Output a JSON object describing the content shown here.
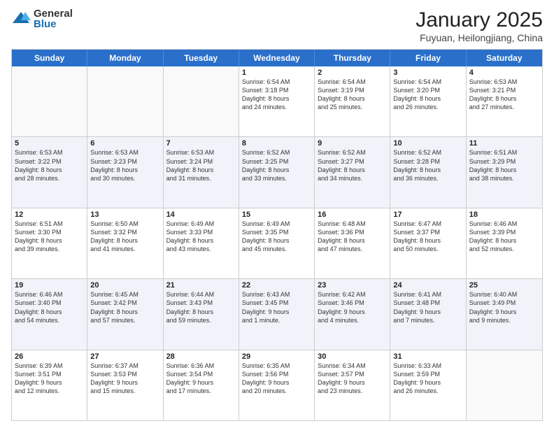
{
  "logo": {
    "general": "General",
    "blue": "Blue"
  },
  "header": {
    "month": "January 2025",
    "location": "Fuyuan, Heilongjiang, China"
  },
  "days": [
    "Sunday",
    "Monday",
    "Tuesday",
    "Wednesday",
    "Thursday",
    "Friday",
    "Saturday"
  ],
  "weeks": [
    [
      {
        "day": "",
        "content": ""
      },
      {
        "day": "",
        "content": ""
      },
      {
        "day": "",
        "content": ""
      },
      {
        "day": "1",
        "content": "Sunrise: 6:54 AM\nSunset: 3:18 PM\nDaylight: 8 hours\nand 24 minutes."
      },
      {
        "day": "2",
        "content": "Sunrise: 6:54 AM\nSunset: 3:19 PM\nDaylight: 8 hours\nand 25 minutes."
      },
      {
        "day": "3",
        "content": "Sunrise: 6:54 AM\nSunset: 3:20 PM\nDaylight: 8 hours\nand 26 minutes."
      },
      {
        "day": "4",
        "content": "Sunrise: 6:53 AM\nSunset: 3:21 PM\nDaylight: 8 hours\nand 27 minutes."
      }
    ],
    [
      {
        "day": "5",
        "content": "Sunrise: 6:53 AM\nSunset: 3:22 PM\nDaylight: 8 hours\nand 28 minutes."
      },
      {
        "day": "6",
        "content": "Sunrise: 6:53 AM\nSunset: 3:23 PM\nDaylight: 8 hours\nand 30 minutes."
      },
      {
        "day": "7",
        "content": "Sunrise: 6:53 AM\nSunset: 3:24 PM\nDaylight: 8 hours\nand 31 minutes."
      },
      {
        "day": "8",
        "content": "Sunrise: 6:52 AM\nSunset: 3:25 PM\nDaylight: 8 hours\nand 33 minutes."
      },
      {
        "day": "9",
        "content": "Sunrise: 6:52 AM\nSunset: 3:27 PM\nDaylight: 8 hours\nand 34 minutes."
      },
      {
        "day": "10",
        "content": "Sunrise: 6:52 AM\nSunset: 3:28 PM\nDaylight: 8 hours\nand 36 minutes."
      },
      {
        "day": "11",
        "content": "Sunrise: 6:51 AM\nSunset: 3:29 PM\nDaylight: 8 hours\nand 38 minutes."
      }
    ],
    [
      {
        "day": "12",
        "content": "Sunrise: 6:51 AM\nSunset: 3:30 PM\nDaylight: 8 hours\nand 39 minutes."
      },
      {
        "day": "13",
        "content": "Sunrise: 6:50 AM\nSunset: 3:32 PM\nDaylight: 8 hours\nand 41 minutes."
      },
      {
        "day": "14",
        "content": "Sunrise: 6:49 AM\nSunset: 3:33 PM\nDaylight: 8 hours\nand 43 minutes."
      },
      {
        "day": "15",
        "content": "Sunrise: 6:49 AM\nSunset: 3:35 PM\nDaylight: 8 hours\nand 45 minutes."
      },
      {
        "day": "16",
        "content": "Sunrise: 6:48 AM\nSunset: 3:36 PM\nDaylight: 8 hours\nand 47 minutes."
      },
      {
        "day": "17",
        "content": "Sunrise: 6:47 AM\nSunset: 3:37 PM\nDaylight: 8 hours\nand 50 minutes."
      },
      {
        "day": "18",
        "content": "Sunrise: 6:46 AM\nSunset: 3:39 PM\nDaylight: 8 hours\nand 52 minutes."
      }
    ],
    [
      {
        "day": "19",
        "content": "Sunrise: 6:46 AM\nSunset: 3:40 PM\nDaylight: 8 hours\nand 54 minutes."
      },
      {
        "day": "20",
        "content": "Sunrise: 6:45 AM\nSunset: 3:42 PM\nDaylight: 8 hours\nand 57 minutes."
      },
      {
        "day": "21",
        "content": "Sunrise: 6:44 AM\nSunset: 3:43 PM\nDaylight: 8 hours\nand 59 minutes."
      },
      {
        "day": "22",
        "content": "Sunrise: 6:43 AM\nSunset: 3:45 PM\nDaylight: 9 hours\nand 1 minute."
      },
      {
        "day": "23",
        "content": "Sunrise: 6:42 AM\nSunset: 3:46 PM\nDaylight: 9 hours\nand 4 minutes."
      },
      {
        "day": "24",
        "content": "Sunrise: 6:41 AM\nSunset: 3:48 PM\nDaylight: 9 hours\nand 7 minutes."
      },
      {
        "day": "25",
        "content": "Sunrise: 6:40 AM\nSunset: 3:49 PM\nDaylight: 9 hours\nand 9 minutes."
      }
    ],
    [
      {
        "day": "26",
        "content": "Sunrise: 6:39 AM\nSunset: 3:51 PM\nDaylight: 9 hours\nand 12 minutes."
      },
      {
        "day": "27",
        "content": "Sunrise: 6:37 AM\nSunset: 3:53 PM\nDaylight: 9 hours\nand 15 minutes."
      },
      {
        "day": "28",
        "content": "Sunrise: 6:36 AM\nSunset: 3:54 PM\nDaylight: 9 hours\nand 17 minutes."
      },
      {
        "day": "29",
        "content": "Sunrise: 6:35 AM\nSunset: 3:56 PM\nDaylight: 9 hours\nand 20 minutes."
      },
      {
        "day": "30",
        "content": "Sunrise: 6:34 AM\nSunset: 3:57 PM\nDaylight: 9 hours\nand 23 minutes."
      },
      {
        "day": "31",
        "content": "Sunrise: 6:33 AM\nSunset: 3:59 PM\nDaylight: 9 hours\nand 26 minutes."
      },
      {
        "day": "",
        "content": ""
      }
    ]
  ]
}
